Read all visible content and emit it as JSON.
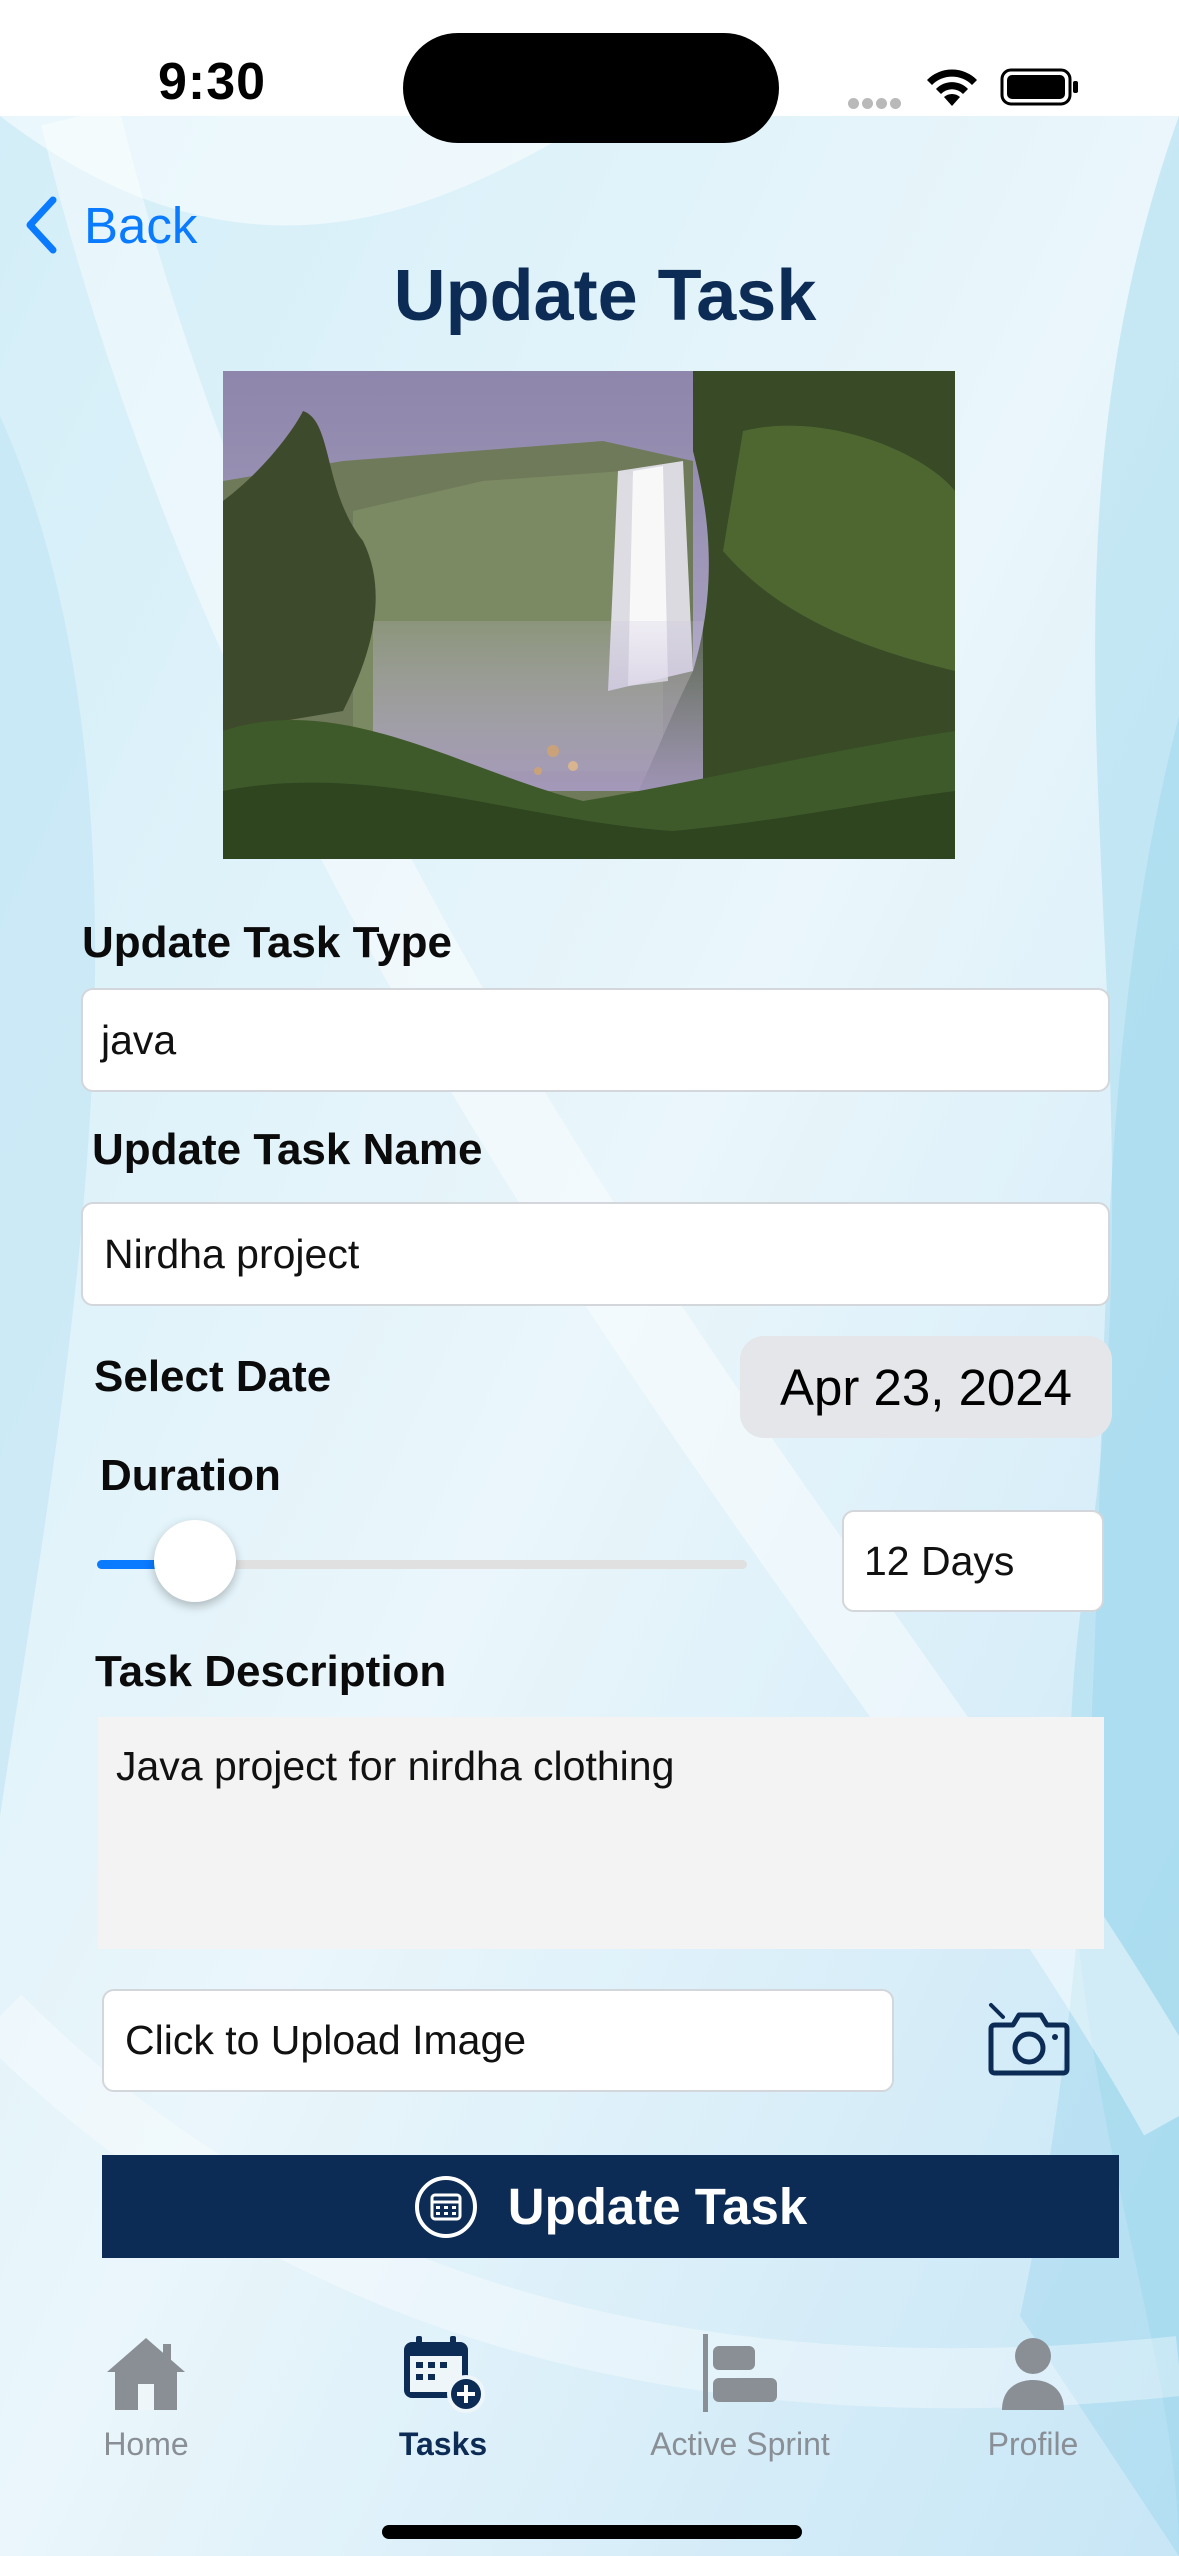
{
  "status_bar": {
    "time": "9:30"
  },
  "nav": {
    "back_label": "Back",
    "title": "Update Task"
  },
  "hero_image": {
    "icon": "waterfall-photo"
  },
  "form": {
    "task_type_label": "Update Task Type",
    "task_type_value": "java",
    "task_name_label": "Update Task Name",
    "task_name_value": "Nirdha project",
    "date_label": "Select Date",
    "date_value": "Apr 23, 2024",
    "duration_label": "Duration",
    "duration_slider_fraction": 0.15,
    "duration_value": "12 Days",
    "description_label": "Task Description",
    "description_value": "Java project for nirdha clothing",
    "upload_label": "Click to Upload Image",
    "camera_icon": "camera-icon",
    "submit_label": "Update Task"
  },
  "tab_bar": {
    "items": [
      {
        "label": "Home",
        "icon": "house-icon",
        "active": false
      },
      {
        "label": "Tasks",
        "icon": "calendar-plus-icon",
        "active": true
      },
      {
        "label": "Active Sprint",
        "icon": "timeline-icon",
        "active": false
      },
      {
        "label": "Profile",
        "icon": "person-icon",
        "active": false
      }
    ]
  },
  "colors": {
    "accent": "#0a7aff",
    "brand_navy": "#0c2c56",
    "inactive_tab": "#8a8f96"
  }
}
